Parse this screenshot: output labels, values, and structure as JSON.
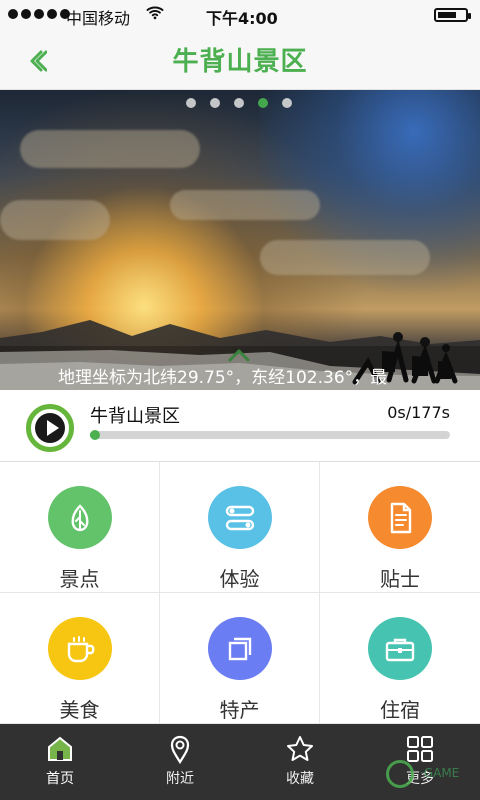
{
  "status_bar": {
    "carrier": "中国移动",
    "time": "下午4:00"
  },
  "header": {
    "title": "牛背山景区"
  },
  "hero": {
    "caption": "地理坐标为北纬29.75°，东经102.36°，最",
    "active_dot_index": 3,
    "dot_count": 5
  },
  "audio": {
    "title": "牛背山景区",
    "time": "0s/177s",
    "progress_fraction": 0.01
  },
  "grid": {
    "items": [
      {
        "label": "景点",
        "icon": "leaf-icon",
        "color": "#63c36b"
      },
      {
        "label": "体验",
        "icon": "toggle-icon",
        "color": "#59c0e6"
      },
      {
        "label": "贴士",
        "icon": "document-icon",
        "color": "#f58a2f"
      },
      {
        "label": "美食",
        "icon": "cup-icon",
        "color": "#f7c612"
      },
      {
        "label": "特产",
        "icon": "copy-icon",
        "color": "#6b7df2"
      },
      {
        "label": "住宿",
        "icon": "suitcase-icon",
        "color": "#47c3b1"
      }
    ]
  },
  "bottom_nav": {
    "items": [
      {
        "label": "首页",
        "icon": "home-icon",
        "active": true
      },
      {
        "label": "附近",
        "icon": "location-pin-icon",
        "active": false
      },
      {
        "label": "收藏",
        "icon": "star-icon",
        "active": false
      },
      {
        "label": "更多",
        "icon": "grid-icon",
        "active": false
      }
    ]
  },
  "watermark": {
    "text": "·GAME"
  },
  "colors": {
    "brand_green": "#4caf50",
    "nav_bg": "#313131",
    "header_bg": "#f7f7f7"
  }
}
